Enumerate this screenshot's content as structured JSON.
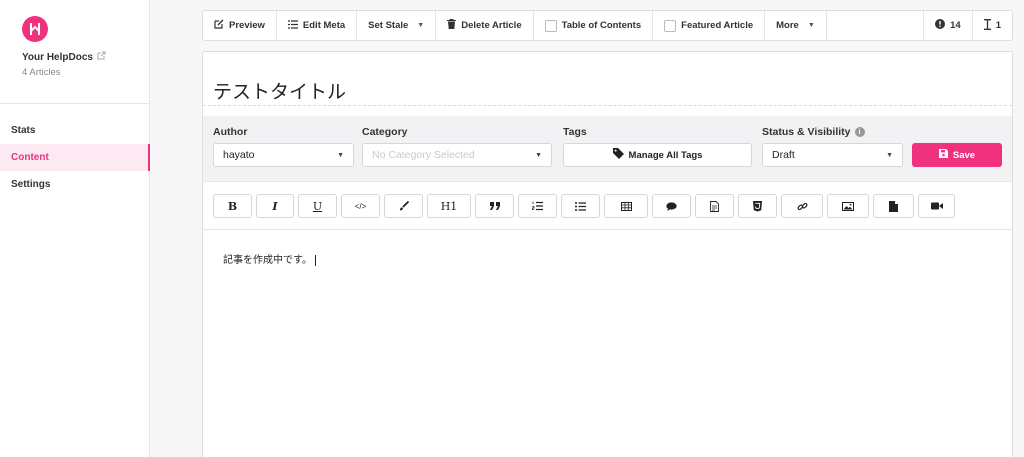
{
  "sidebar": {
    "brand": "Your HelpDocs",
    "article_count": "4 Articles",
    "items": [
      {
        "label": "Stats"
      },
      {
        "label": "Content"
      },
      {
        "label": "Settings"
      }
    ]
  },
  "toolbar": {
    "preview": "Preview",
    "edit_meta": "Edit Meta",
    "set_stale": "Set Stale",
    "delete_article": "Delete Article",
    "table_of_contents": "Table of Contents",
    "featured_article": "Featured Article",
    "more": "More",
    "info_count": "14",
    "cursor_count": "1"
  },
  "article": {
    "title": "テストタイトル",
    "body": "記事を作成中です。"
  },
  "meta": {
    "author_label": "Author",
    "author_value": "hayato",
    "category_label": "Category",
    "category_placeholder": "No Category Selected",
    "tags_label": "Tags",
    "manage_tags": "Manage All Tags",
    "status_label": "Status & Visibility",
    "status_value": "Draft",
    "save": "Save"
  },
  "format_buttons": {
    "bold": "B",
    "italic": "I",
    "underline": "U",
    "code": "</>",
    "heading": "H1"
  },
  "colors": {
    "accent": "#f0317e"
  }
}
